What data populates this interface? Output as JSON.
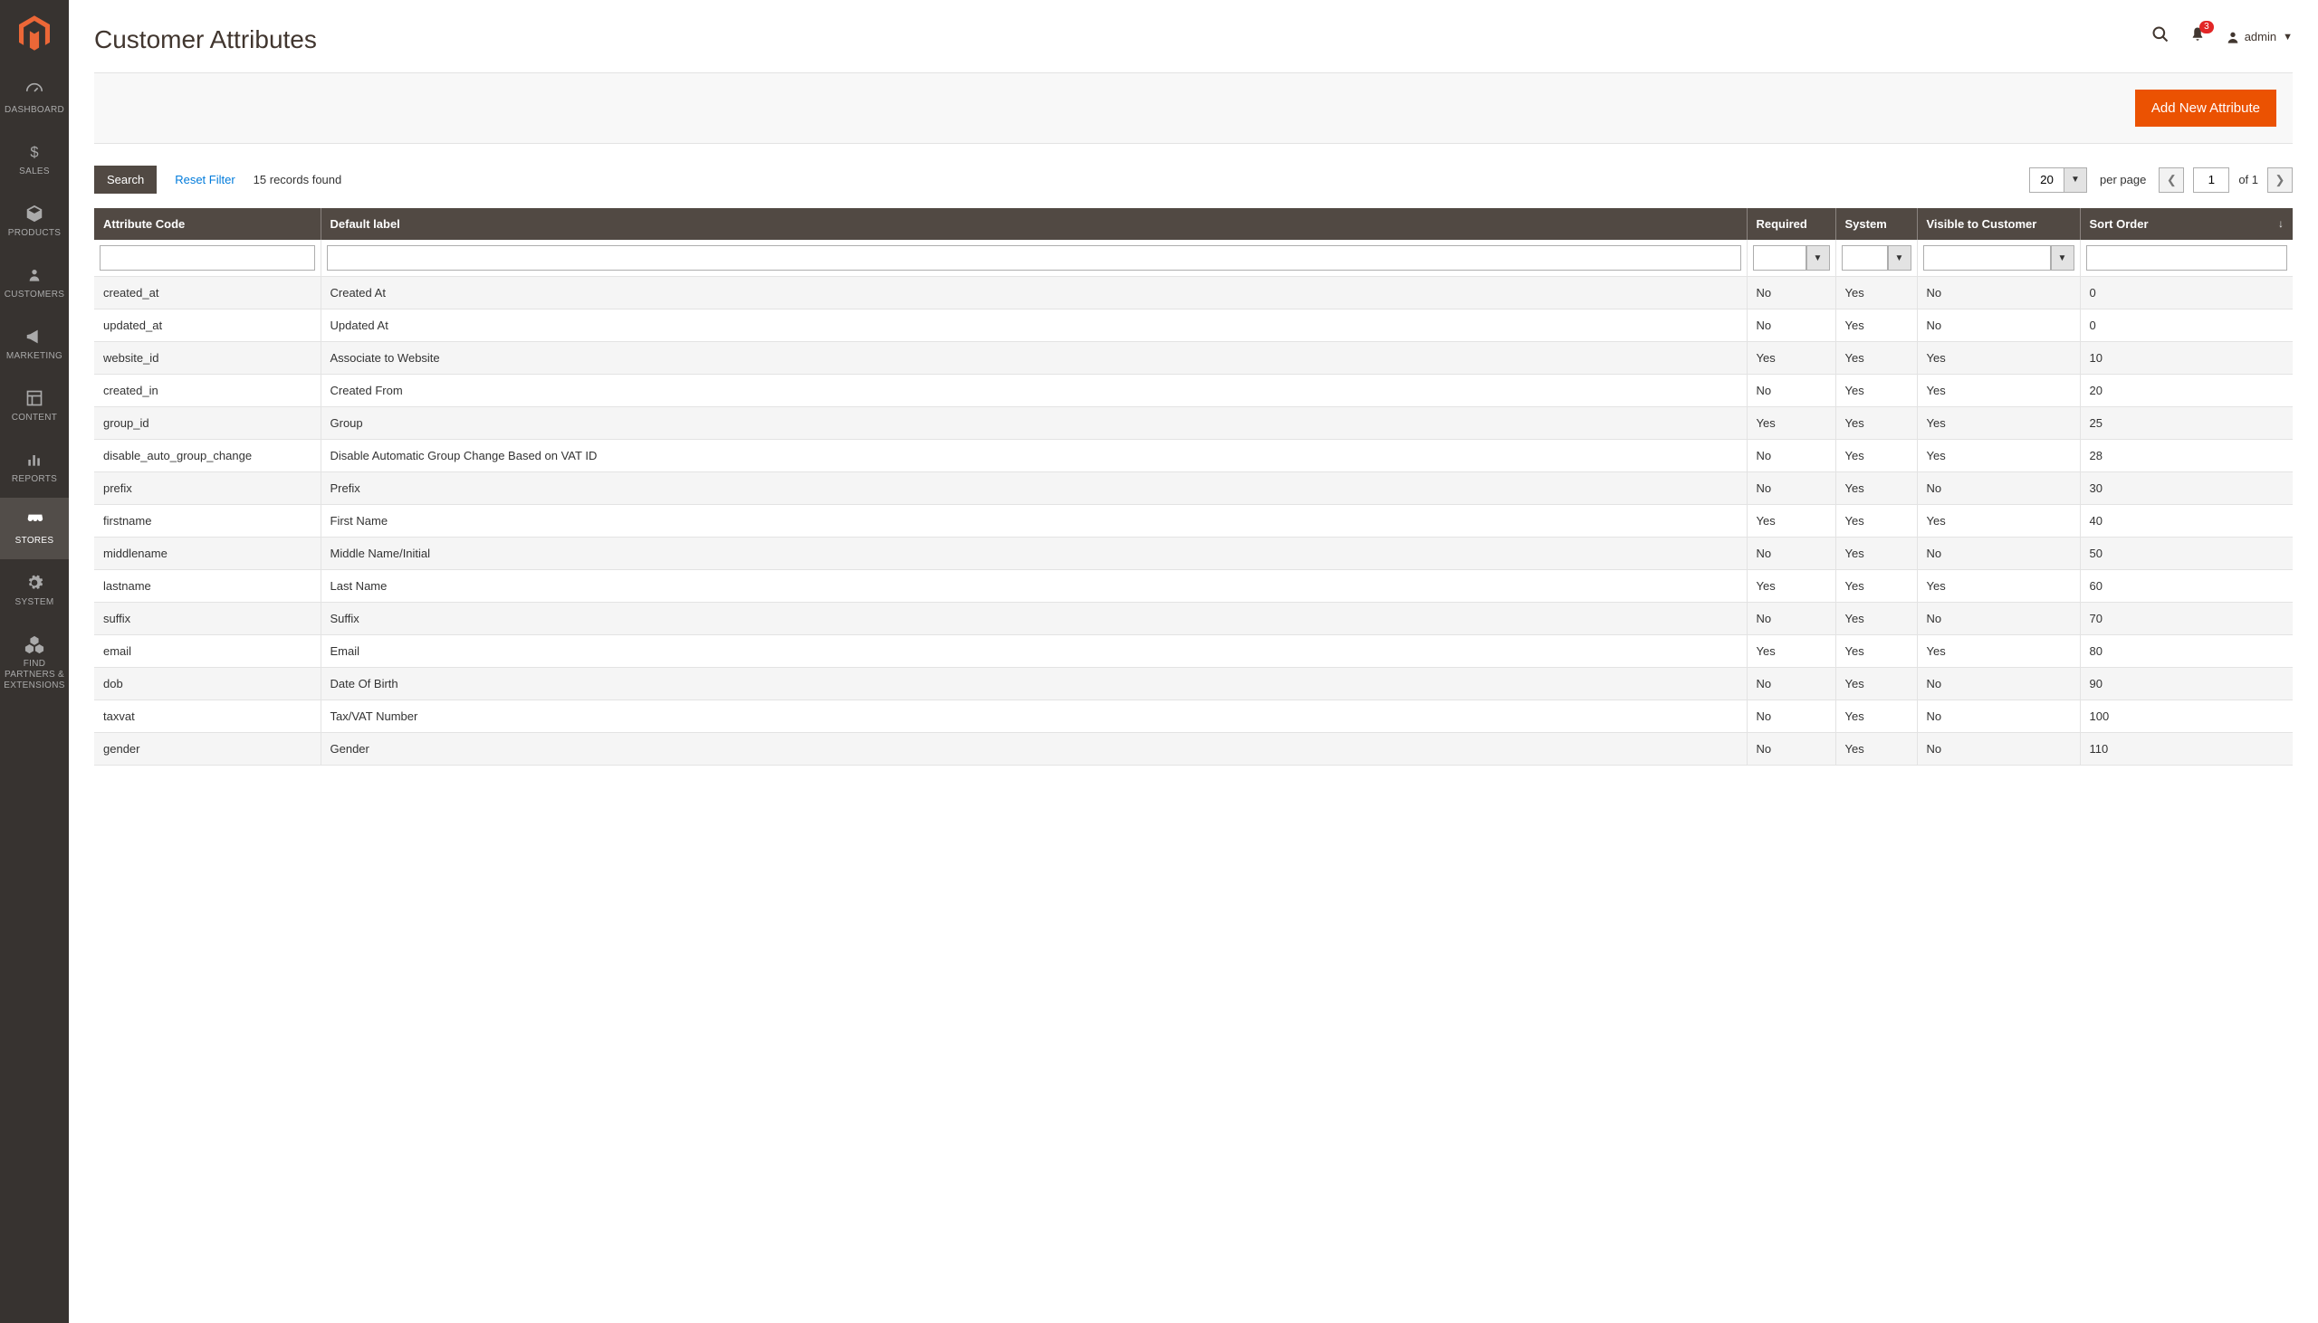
{
  "page": {
    "title": "Customer Attributes"
  },
  "header": {
    "user_label": "admin",
    "notif_count": "3"
  },
  "sidebar": [
    {
      "label": "DASHBOARD",
      "icon": "gauge"
    },
    {
      "label": "SALES",
      "icon": "dollar"
    },
    {
      "label": "PRODUCTS",
      "icon": "box"
    },
    {
      "label": "CUSTOMERS",
      "icon": "person"
    },
    {
      "label": "MARKETING",
      "icon": "megaphone"
    },
    {
      "label": "CONTENT",
      "icon": "layout"
    },
    {
      "label": "REPORTS",
      "icon": "bars"
    },
    {
      "label": "STORES",
      "icon": "store",
      "active": true
    },
    {
      "label": "SYSTEM",
      "icon": "gear"
    },
    {
      "label": "FIND PARTNERS & EXTENSIONS",
      "icon": "cubes"
    }
  ],
  "action_bar": {
    "add_label": "Add New Attribute"
  },
  "toolbar": {
    "search_label": "Search",
    "reset_label": "Reset Filter",
    "records_text": "15 records found",
    "per_page_value": "20",
    "per_page_label": "per page",
    "page_value": "1",
    "of_label": "of 1"
  },
  "columns": {
    "attr_code": "Attribute Code",
    "default_label": "Default label",
    "required": "Required",
    "system": "System",
    "visible": "Visible to Customer",
    "sort_order": "Sort Order"
  },
  "rows": [
    {
      "code": "created_at",
      "label": "Created At",
      "required": "No",
      "system": "Yes",
      "visible": "No",
      "sort": "0"
    },
    {
      "code": "updated_at",
      "label": "Updated At",
      "required": "No",
      "system": "Yes",
      "visible": "No",
      "sort": "0"
    },
    {
      "code": "website_id",
      "label": "Associate to Website",
      "required": "Yes",
      "system": "Yes",
      "visible": "Yes",
      "sort": "10"
    },
    {
      "code": "created_in",
      "label": "Created From",
      "required": "No",
      "system": "Yes",
      "visible": "Yes",
      "sort": "20"
    },
    {
      "code": "group_id",
      "label": "Group",
      "required": "Yes",
      "system": "Yes",
      "visible": "Yes",
      "sort": "25"
    },
    {
      "code": "disable_auto_group_change",
      "label": "Disable Automatic Group Change Based on VAT ID",
      "required": "No",
      "system": "Yes",
      "visible": "Yes",
      "sort": "28"
    },
    {
      "code": "prefix",
      "label": "Prefix",
      "required": "No",
      "system": "Yes",
      "visible": "No",
      "sort": "30"
    },
    {
      "code": "firstname",
      "label": "First Name",
      "required": "Yes",
      "system": "Yes",
      "visible": "Yes",
      "sort": "40"
    },
    {
      "code": "middlename",
      "label": "Middle Name/Initial",
      "required": "No",
      "system": "Yes",
      "visible": "No",
      "sort": "50"
    },
    {
      "code": "lastname",
      "label": "Last Name",
      "required": "Yes",
      "system": "Yes",
      "visible": "Yes",
      "sort": "60"
    },
    {
      "code": "suffix",
      "label": "Suffix",
      "required": "No",
      "system": "Yes",
      "visible": "No",
      "sort": "70"
    },
    {
      "code": "email",
      "label": "Email",
      "required": "Yes",
      "system": "Yes",
      "visible": "Yes",
      "sort": "80"
    },
    {
      "code": "dob",
      "label": "Date Of Birth",
      "required": "No",
      "system": "Yes",
      "visible": "No",
      "sort": "90"
    },
    {
      "code": "taxvat",
      "label": "Tax/VAT Number",
      "required": "No",
      "system": "Yes",
      "visible": "No",
      "sort": "100"
    },
    {
      "code": "gender",
      "label": "Gender",
      "required": "No",
      "system": "Yes",
      "visible": "No",
      "sort": "110"
    }
  ]
}
